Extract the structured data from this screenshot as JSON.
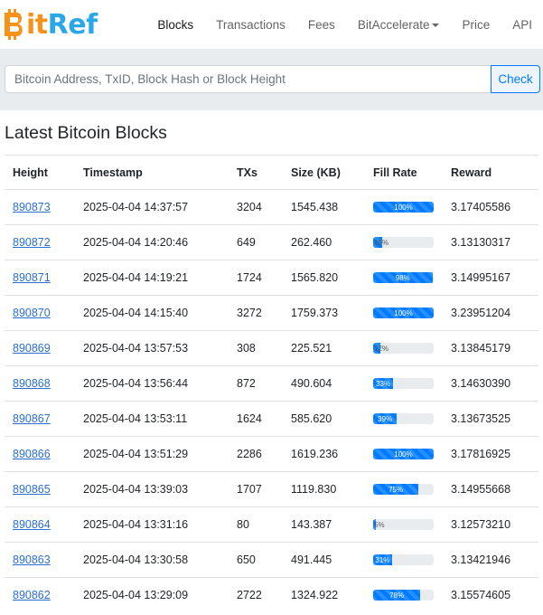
{
  "brand": {
    "name_prefix": "B",
    "name_it": "it",
    "name_ref": "Ref"
  },
  "nav": {
    "items": [
      "Blocks",
      "Transactions",
      "Fees",
      "BitAccelerate",
      "Price",
      "API"
    ]
  },
  "search": {
    "placeholder": "Bitcoin Address, TxID, Block Hash or Block Height",
    "button_label": "Check"
  },
  "page_title": "Latest Bitcoin Blocks",
  "table": {
    "headers": [
      "Height",
      "Timestamp",
      "TXs",
      "Size (KB)",
      "Fill Rate",
      "Reward"
    ],
    "rows": [
      {
        "height": "890873",
        "timestamp": "2025-04-04 14:37:57",
        "txs": "3204",
        "size": "1545.438",
        "fill_label": "100%",
        "fill": 100,
        "reward": "3.17405586"
      },
      {
        "height": "890872",
        "timestamp": "2025-04-04 14:20:46",
        "txs": "649",
        "size": "262.460",
        "fill_label": "15%",
        "fill": 15,
        "reward": "3.13130317"
      },
      {
        "height": "890871",
        "timestamp": "2025-04-04 14:19:21",
        "txs": "1724",
        "size": "1565.820",
        "fill_label": "98%",
        "fill": 98,
        "reward": "3.14995167"
      },
      {
        "height": "890870",
        "timestamp": "2025-04-04 14:15:40",
        "txs": "3272",
        "size": "1759.373",
        "fill_label": "100%",
        "fill": 100,
        "reward": "3.23951204"
      },
      {
        "height": "890869",
        "timestamp": "2025-04-04 13:57:53",
        "txs": "308",
        "size": "225.521",
        "fill_label": "12%",
        "fill": 12,
        "reward": "3.13845179"
      },
      {
        "height": "890868",
        "timestamp": "2025-04-04 13:56:44",
        "txs": "872",
        "size": "490.604",
        "fill_label": "33%",
        "fill": 33,
        "reward": "3.14630390"
      },
      {
        "height": "890867",
        "timestamp": "2025-04-04 13:53:11",
        "txs": "1624",
        "size": "585.620",
        "fill_label": "39%",
        "fill": 39,
        "reward": "3.13673525"
      },
      {
        "height": "890866",
        "timestamp": "2025-04-04 13:51:29",
        "txs": "2286",
        "size": "1619.236",
        "fill_label": "100%",
        "fill": 100,
        "reward": "3.17816925"
      },
      {
        "height": "890865",
        "timestamp": "2025-04-04 13:39:03",
        "txs": "1707",
        "size": "1119.830",
        "fill_label": "75%",
        "fill": 75,
        "reward": "3.14955668"
      },
      {
        "height": "890864",
        "timestamp": "2025-04-04 13:31:16",
        "txs": "80",
        "size": "143.387",
        "fill_label": "5%",
        "fill": 5,
        "reward": "3.12573210"
      },
      {
        "height": "890863",
        "timestamp": "2025-04-04 13:30:58",
        "txs": "650",
        "size": "491.445",
        "fill_label": "31%",
        "fill": 31,
        "reward": "3.13421946"
      },
      {
        "height": "890862",
        "timestamp": "2025-04-04 13:29:09",
        "txs": "2722",
        "size": "1324.922",
        "fill_label": "78%",
        "fill": 78,
        "reward": "3.15574605"
      }
    ]
  },
  "colors": {
    "brand_orange": "#f7931a",
    "brand_blue": "#2aa7e8",
    "accent": "#007bff",
    "link": "#2a6fce"
  },
  "icons": {
    "logo_mark": "bitcoin-b-icon",
    "dropdown": "caret-down-icon"
  }
}
